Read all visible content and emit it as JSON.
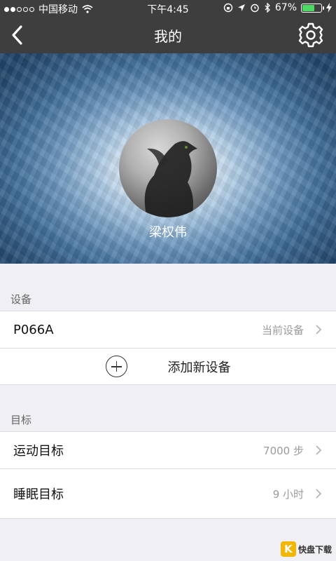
{
  "status_bar": {
    "carrier": "中国移动",
    "time": "下午4:45",
    "battery_percent": "67%",
    "battery_level": 0.67,
    "signal_icon": "signal-dots",
    "wifi_icon": "wifi-icon",
    "right_icons": [
      "lock-rotation-icon",
      "location-arrow-icon",
      "alarm-icon",
      "bluetooth-icon",
      "charging-icon"
    ]
  },
  "nav": {
    "title": "我的",
    "back_icon": "back-chevron-icon",
    "settings_icon": "gear-icon"
  },
  "profile": {
    "username": "梁权伟"
  },
  "devices": {
    "header": "设备",
    "items": [
      {
        "name": "P066A",
        "value": "当前设备"
      }
    ],
    "add_label": "添加新设备"
  },
  "goals": {
    "header": "目标",
    "items": [
      {
        "name": "运动目标",
        "value": "7000 步"
      },
      {
        "name": "睡眠目标",
        "value": "9 小时"
      }
    ]
  },
  "watermark": {
    "logo_letter": "K",
    "text": "快盘下载"
  },
  "colors": {
    "nav_bg": "#3e3e3e",
    "page_bg": "#efeff4",
    "battery_green": "#4cd964"
  }
}
